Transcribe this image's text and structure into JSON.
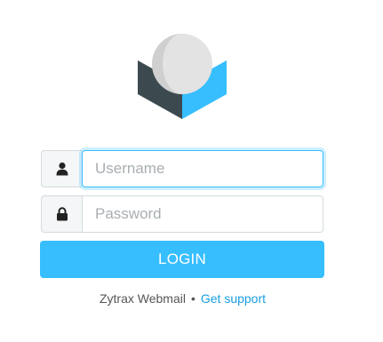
{
  "login_form": {
    "username": {
      "placeholder": "Username",
      "value": "",
      "icon": "user-icon"
    },
    "password": {
      "placeholder": "Password",
      "value": "",
      "icon": "lock-icon"
    },
    "submit_label": "LOGIN"
  },
  "footer": {
    "product_name": "Zytrax Webmail",
    "separator": "•",
    "support_link": "Get support"
  },
  "colors": {
    "accent": "#37beff",
    "logo_dark": "#3c4a50",
    "logo_blue": "#37beff",
    "logo_sphere": "#e0e0e0"
  }
}
